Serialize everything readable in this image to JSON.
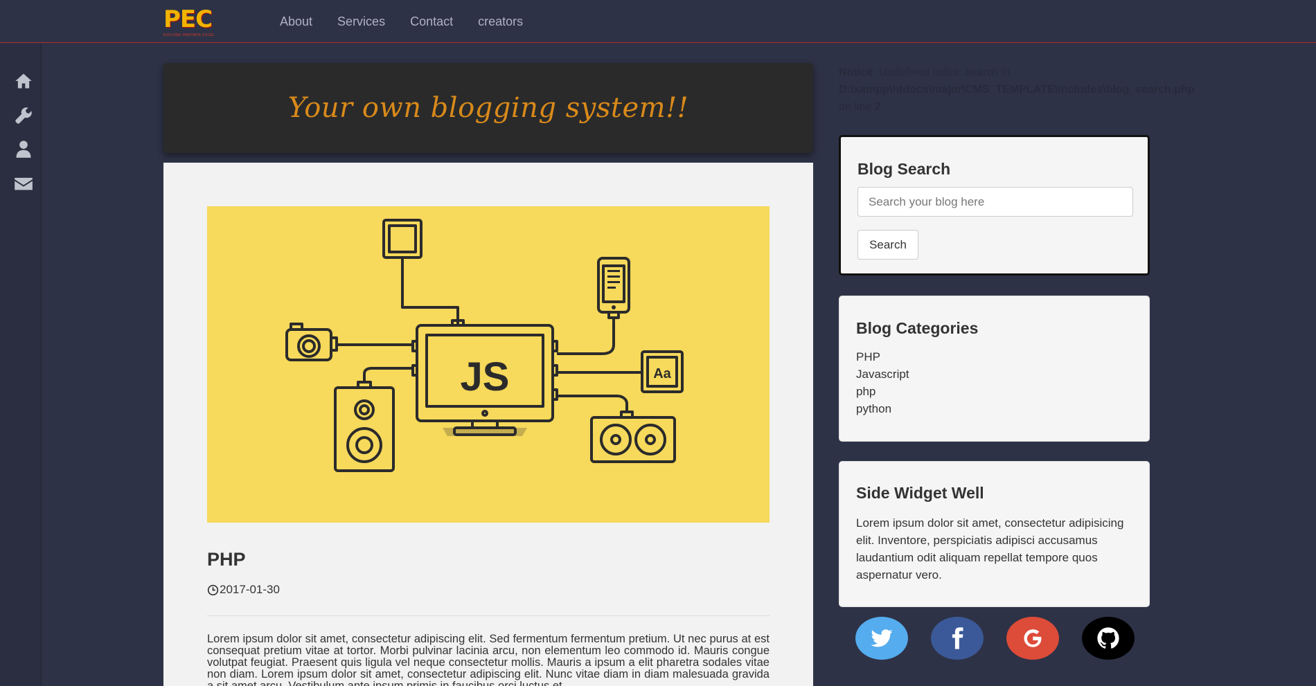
{
  "navbar": {
    "logo_text": "PEC",
    "logo_tagline": "EXPLORE INNOVATE EXCEL",
    "links": [
      "About",
      "Services",
      "Contact",
      "creators"
    ]
  },
  "siderail": {
    "icons": [
      "home-icon",
      "wrench-icon",
      "user-icon",
      "envelope-icon"
    ]
  },
  "banner": {
    "text": "Your own blogging system!!"
  },
  "post": {
    "image_label": "JS",
    "image_badge": "Aa",
    "title": "PHP",
    "date": "2017-01-30",
    "body": "Lorem ipsum dolor sit amet, consectetur adipiscing elit. Sed fermentum fermentum pretium. Ut nec purus at est consequat pretium vitae at tortor. Morbi pulvinar lacinia arcu, non elementum leo commodo id. Mauris congue volutpat feugiat. Praesent quis ligula vel neque consectetur mollis. Mauris a ipsum a elit pharetra sodales vitae non diam. Lorem ipsum dolor sit amet, consectetur adipiscing elit. Nunc vitae diam in diam malesuada gravida a sit amet arcu. Vestibulum ante ipsum primis in faucibus orci luctus et"
  },
  "notice": {
    "label": "Notice",
    "message": ": Undefined index: search in",
    "path": "D:\\xampp\\htdocs\\major\\CMS_TEMPLATE\\includes\\blog_search.php",
    "line_prefix": "on line",
    "line_number": "2"
  },
  "search_well": {
    "title": "Blog Search",
    "placeholder": "Search your blog here",
    "button_label": "Search"
  },
  "categories_well": {
    "title": "Blog Categories",
    "items": [
      "PHP",
      "Javascript",
      "php",
      "python"
    ]
  },
  "widget_well": {
    "title": "Side Widget Well",
    "text": "Lorem ipsum dolor sit amet, consectetur adipisicing elit. Inventore, perspiciatis adipisci accusamus laudantium odit aliquam repellat tempore quos aspernatur vero."
  },
  "social": {
    "icons": [
      "twitter-icon",
      "facebook-icon",
      "google-icon",
      "github-icon"
    ],
    "colors": {
      "twitter": "#55acee",
      "facebook": "#3b5998",
      "google": "#dd4b39",
      "github": "#000000"
    }
  },
  "colors": {
    "page_bg": "#2e3246",
    "banner_text": "#d98a1a",
    "image_bg": "#f7d95b",
    "logo": "#f0b400"
  }
}
